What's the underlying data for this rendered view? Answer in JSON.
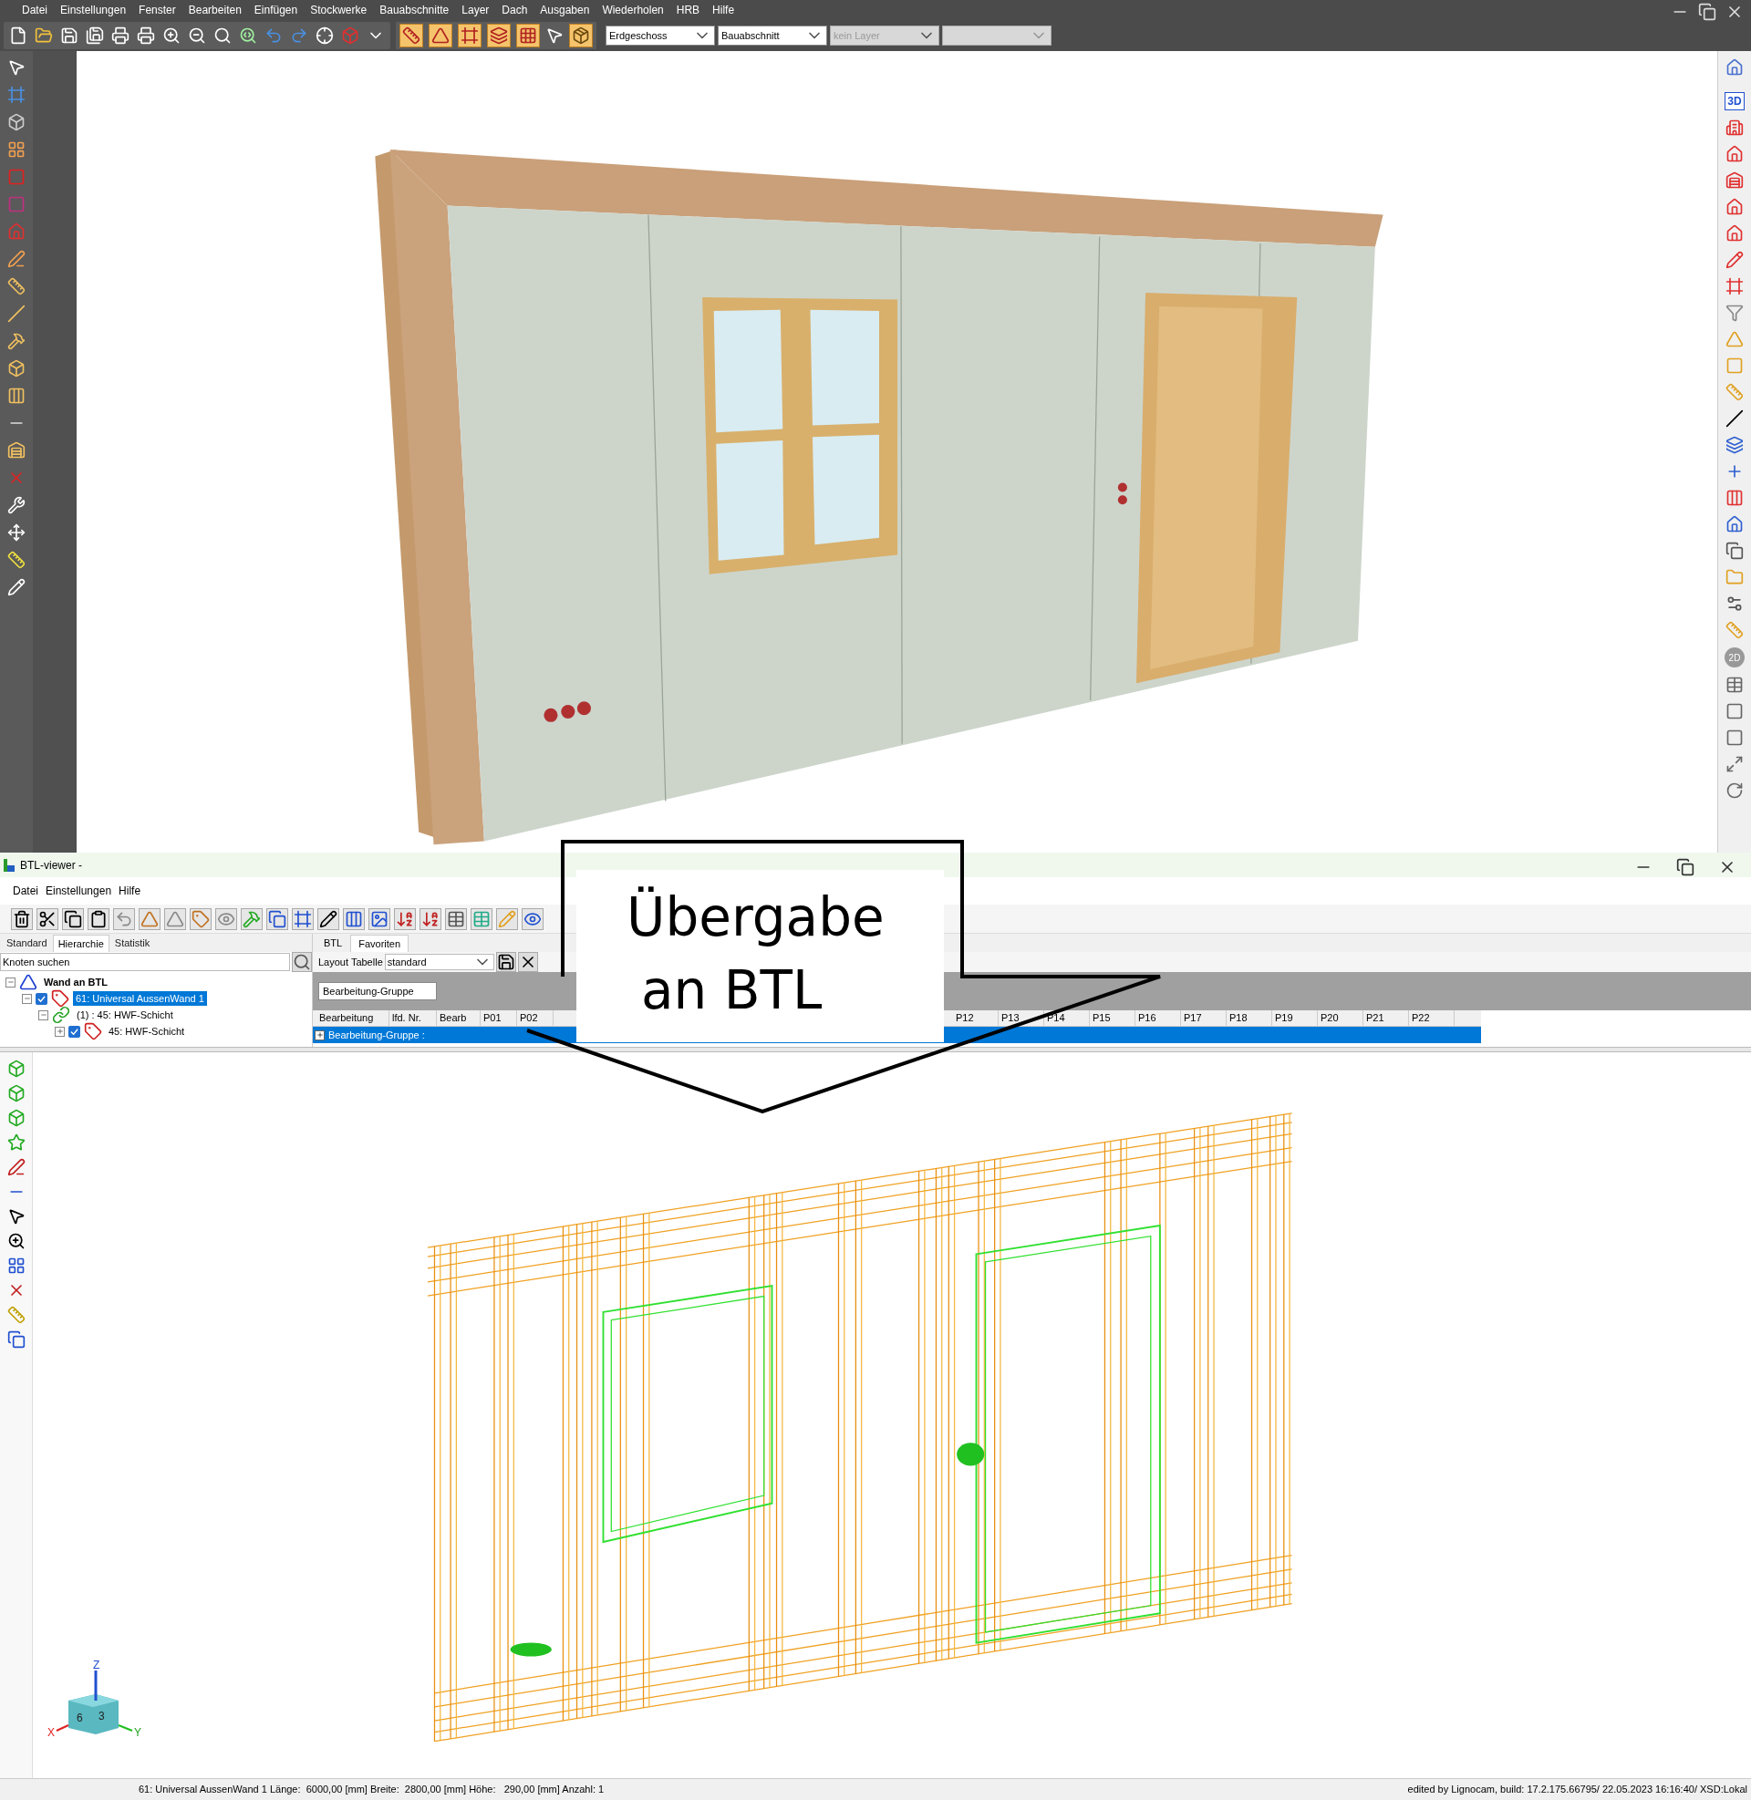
{
  "cad": {
    "menu": [
      "Datei",
      "Einstellungen",
      "Fenster",
      "Bearbeiten",
      "Einfügen",
      "Stockwerke",
      "Bauabschnitte",
      "Layer",
      "Dach",
      "Ausgaben",
      "Wiederholen",
      "HRB",
      "Hilfe"
    ],
    "selects": [
      {
        "value": "Erdgeschoss",
        "disabled": false
      },
      {
        "value": "Bauabschnitt",
        "disabled": false
      },
      {
        "value": "kein Layer",
        "disabled": true
      }
    ],
    "right_labels": [
      "3D",
      "2D"
    ]
  },
  "callout": {
    "lines": [
      "Übergabe",
      "an BTL"
    ]
  },
  "btl": {
    "title": "BTL-viewer -",
    "menu": [
      "Datei",
      "Einstellungen",
      "Hilfe"
    ],
    "left_tabs": [
      {
        "label": "Standard",
        "selected": false
      },
      {
        "label": "Hierarchie",
        "selected": true
      },
      {
        "label": "Statistik",
        "selected": false
      }
    ],
    "search": {
      "placeholder": "Knoten suchen"
    },
    "tree": [
      {
        "label": "Wand an BTL",
        "kind": "root",
        "expanded": true,
        "selected": false,
        "children": [
          {
            "label": "61: Universal AussenWand 1",
            "kind": "element",
            "checked": true,
            "expanded": true,
            "selected": true,
            "children": [
              {
                "label": "(1) : 45: HWF-Schicht",
                "kind": "link",
                "expanded": true,
                "selected": false,
                "children": [
                  {
                    "label": "45: HWF-Schicht",
                    "kind": "element",
                    "checked": true,
                    "expanded": false,
                    "selected": false
                  }
                ]
              }
            ]
          }
        ]
      }
    ],
    "right_tabs": [
      {
        "label": "BTL",
        "selected": false
      },
      {
        "label": "Favoriten",
        "selected": true
      }
    ],
    "layout_label": "Layout Tabelle",
    "layout_value": "standard",
    "group_chip": "Bearbeitung-Gruppe",
    "columns_left": [
      "Bearbeitung",
      "lfd. Nr.",
      "Bearb",
      "P01",
      "P02"
    ],
    "columns_right": [
      "P12",
      "P13",
      "P14",
      "P15",
      "P16",
      "P17",
      "P18",
      "P19",
      "P20",
      "P21",
      "P22"
    ],
    "rows": [
      {
        "label": "Bearbeitung-Gruppe :",
        "selected": true,
        "expanded": false
      }
    ],
    "axes": {
      "z": "Z",
      "x": "X",
      "y": "Y",
      "left_face": "6",
      "right_face": "3"
    }
  },
  "status_bar": {
    "left": "61: Universal AussenWand 1 Länge:  6000,00 [mm] Breite:  2800,00 [mm] Höhe:   290,00 [mm] Anzahl: 1",
    "right": "edited by Lignocam, build: 17.2.175.66795/ 22.05.2023 16:16:40/ XSD:Lokal"
  }
}
